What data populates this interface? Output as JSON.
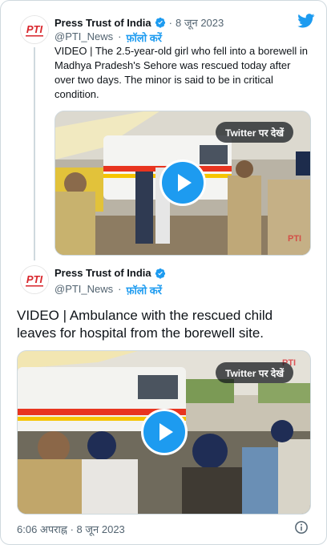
{
  "brand": {
    "accent": "#1d9bf0",
    "pti_red": "#d8262c"
  },
  "tweets": [
    {
      "author": "Press Trust of India",
      "date": "8 जून 2023",
      "handle": "@PTI_News",
      "follow_label": "फ़ॉलो करें",
      "text": "VIDEO | The 2.5-year-old girl who fell into a borewell in Madhya Pradesh's Sehore was rescued today after over two days. The minor is said to be in critical condition.",
      "video": {
        "view_label": "Twitter पर देखें",
        "watermark": "PTI"
      }
    },
    {
      "author": "Press Trust of India",
      "handle": "@PTI_News",
      "follow_label": "फ़ॉलो करें",
      "text": "VIDEO | Ambulance with the rescued child leaves for hospital from the borewell site.",
      "video": {
        "view_label": "Twitter पर देखें",
        "watermark": "PTI"
      },
      "timestamp": "6:06 अपराह्न · 8 जून 2023"
    }
  ],
  "icons": {
    "logo": "twitter-bird-icon",
    "verified": "verified-badge-icon",
    "info": "info-icon"
  }
}
